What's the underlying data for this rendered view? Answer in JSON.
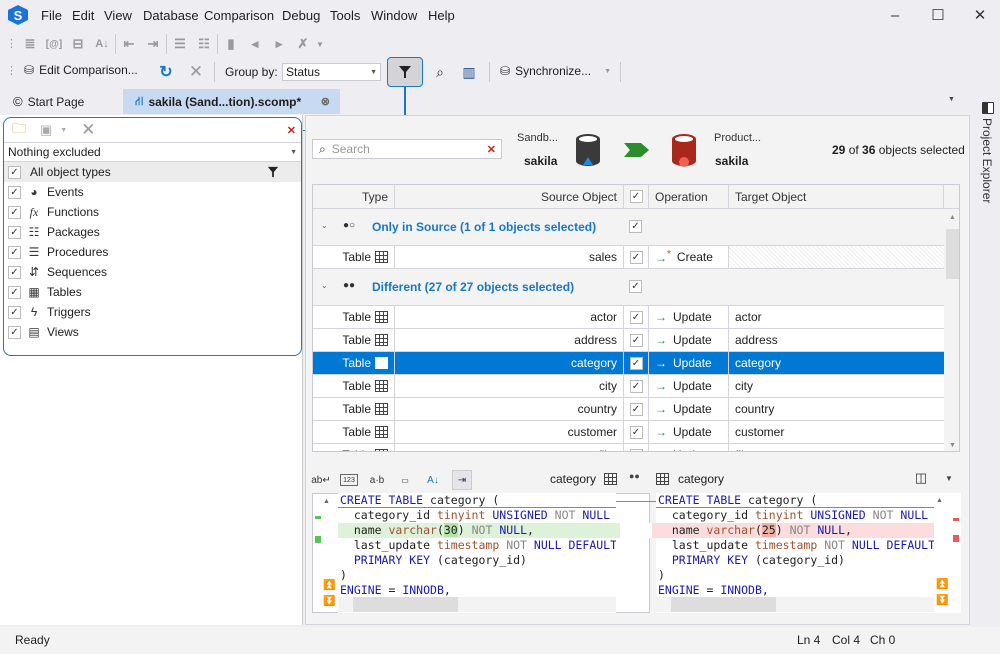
{
  "app": {
    "logo": "S"
  },
  "menu": [
    "File",
    "Edit",
    "View",
    "Database",
    "Comparison",
    "Debug",
    "Tools",
    "Window",
    "Help"
  ],
  "window_controls": {
    "minimize": "–",
    "maximize": "☐",
    "close": "✕"
  },
  "toolbar2": {
    "edit_comparison": "Edit Comparison...",
    "group_by_label": "Group by:",
    "group_by_value": "Status",
    "synchronize": "Synchronize..."
  },
  "tabs": [
    {
      "label": "Start Page",
      "active": false
    },
    {
      "label": "sakila (Sand...tion).scomp*",
      "active": true
    }
  ],
  "filter_popup": {
    "dropdown_value": "Nothing excluded",
    "all_label": "All object types",
    "types": [
      {
        "label": "Events",
        "icon": "events-icon",
        "glyph": "◕",
        "checked": true
      },
      {
        "label": "Functions",
        "icon": "function-icon",
        "glyph": "fx",
        "checked": true
      },
      {
        "label": "Packages",
        "icon": "package-icon",
        "glyph": "☷",
        "checked": true
      },
      {
        "label": "Procedures",
        "icon": "procedure-icon",
        "glyph": "☰",
        "checked": true
      },
      {
        "label": "Sequences",
        "icon": "sequence-icon",
        "glyph": "⇵",
        "checked": true
      },
      {
        "label": "Tables",
        "icon": "table-icon",
        "glyph": "▦",
        "checked": true
      },
      {
        "label": "Triggers",
        "icon": "trigger-icon",
        "glyph": "ϟ",
        "checked": true
      },
      {
        "label": "Views",
        "icon": "view-icon",
        "glyph": "▤",
        "checked": true
      }
    ]
  },
  "search": {
    "placeholder": "Search"
  },
  "source_db": {
    "conn": "Sandb...",
    "name": "sakila",
    "color": "#3a3a3a"
  },
  "target_db": {
    "conn": "Product...",
    "name": "sakila",
    "color": "#a8281c"
  },
  "selection_summary": {
    "selected": "29",
    "of": " of ",
    "total": "36",
    "suffix": " objects selected"
  },
  "grid": {
    "headers": {
      "type": "Type",
      "source": "Source Object",
      "operation": "Operation",
      "target": "Target Object"
    },
    "groups": [
      {
        "title": "Only in Source (1 of 1 objects selected)",
        "marker": "●○",
        "rows": [
          {
            "type": "Table",
            "source": "sales",
            "op": "Create",
            "target": "",
            "selected": false
          }
        ]
      },
      {
        "title": "Different (27 of 27 objects selected)",
        "marker": "●●",
        "rows": [
          {
            "type": "Table",
            "source": "actor",
            "op": "Update",
            "target": "actor",
            "selected": false
          },
          {
            "type": "Table",
            "source": "address",
            "op": "Update",
            "target": "address",
            "selected": false
          },
          {
            "type": "Table",
            "source": "category",
            "op": "Update",
            "target": "category",
            "selected": true
          },
          {
            "type": "Table",
            "source": "city",
            "op": "Update",
            "target": "city",
            "selected": false
          },
          {
            "type": "Table",
            "source": "country",
            "op": "Update",
            "target": "country",
            "selected": false
          },
          {
            "type": "Table",
            "source": "customer",
            "op": "Update",
            "target": "customer",
            "selected": false
          },
          {
            "type": "Table",
            "source": "film",
            "op": "Update",
            "target": "film",
            "selected": false
          }
        ]
      }
    ]
  },
  "diff": {
    "left_object": "category",
    "right_object": "category",
    "left_code": [
      "CREATE TABLE category (",
      "  category_id tinyint UNSIGNED NOT NULL",
      "  name varchar(30) NOT NULL,",
      "  last_update timestamp NOT NULL DEFAULT",
      "  PRIMARY KEY (category_id)",
      ")",
      "ENGINE = INNODB,"
    ],
    "right_code": [
      "CREATE TABLE category (",
      "  category_id tinyint UNSIGNED NOT NULL",
      "  name varchar(25) NOT NULL,",
      "  last_update timestamp NOT NULL DEFAULT",
      "  PRIMARY KEY (category_id)",
      ")",
      "ENGINE = INNODB,"
    ]
  },
  "side_panel": {
    "label": "Project Explorer"
  },
  "status": {
    "text": "Ready",
    "ln": "Ln 4",
    "col": "Col 4",
    "ch": "Ch 0"
  }
}
